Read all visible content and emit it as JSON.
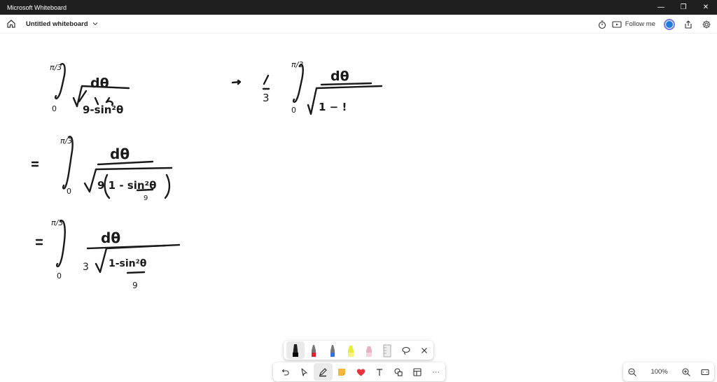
{
  "window": {
    "app_title": "Microsoft Whiteboard",
    "minimize": "—",
    "restore": "❐",
    "close": "✕"
  },
  "header": {
    "board_title": "Untitled whiteboard",
    "follow_me_label": "Follow me",
    "icons": [
      "home-icon",
      "chevron-down-icon",
      "timer-icon",
      "present-icon",
      "avatar",
      "share-icon",
      "gear-icon"
    ]
  },
  "ink": {
    "top_limit": "π/3",
    "bottom_limit": "0",
    "numerator": "dθ",
    "arrow": "→",
    "one": "1",
    "three": "3",
    "equals": "="
  },
  "pen_tray": {
    "items": [
      "black-pen",
      "red-pen",
      "blue-pen",
      "yellow-highlighter",
      "pink-highlighter",
      "ruler",
      "lasso-icon",
      "close-icon"
    ]
  },
  "toolbar": {
    "items": [
      "undo-icon",
      "select-icon",
      "pen-icon",
      "sticky-note-icon",
      "reaction-icon",
      "text-icon",
      "shapes-icon",
      "templates-icon",
      "more-icon"
    ],
    "more": "···"
  },
  "zoom": {
    "level": "100%"
  },
  "colors": {
    "titlebar": "#1f1f1f",
    "accent": "#1e7bdc",
    "ink": "#1a1a1a"
  }
}
